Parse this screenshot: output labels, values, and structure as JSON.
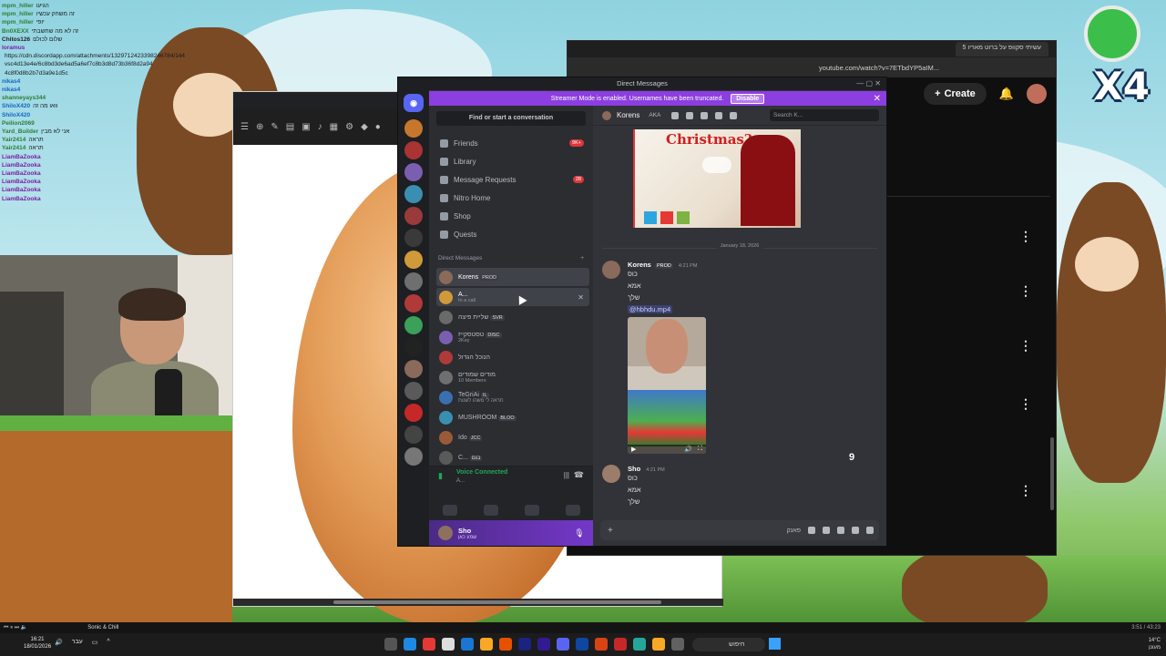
{
  "stream_chat": [
    {
      "user": "mpm_hiller",
      "text": "הגיעו",
      "color": "#2e7d32"
    },
    {
      "user": "mpm_hiller",
      "text": "זה משחק עכשיו",
      "color": "#2e7d32"
    },
    {
      "user": "mpm_hiller",
      "text": "יופי",
      "color": "#2e7d32"
    },
    {
      "user": "Bn0XEXX",
      "text": "זה לא מה שחשבתי",
      "color": "#2e7d32"
    },
    {
      "user": "Chitos126",
      "text": "שלום לכולם",
      "color": "#222222"
    },
    {
      "user": "loramus",
      "text": "",
      "color": "#7b1fa2"
    },
    {
      "user": "",
      "text": "https://cdn.discordapp.com/attachments/1329712423398246784/144",
      "color": "#222222"
    },
    {
      "user": "",
      "text": "vsc4d13e4e/6c8bd3de6ad5a6ef7c8b3d8d73b36f8d2a94",
      "color": "#222222"
    },
    {
      "user": "",
      "text": "4c8f0d8b2b7d3a9e1d5c",
      "color": "#222222"
    },
    {
      "user": "nikas4",
      "text": "",
      "color": "#1565c0"
    },
    {
      "user": "nikas4",
      "text": "",
      "color": "#1565c0"
    },
    {
      "user": "shanneyays344",
      "text": "",
      "color": "#2e7d32"
    },
    {
      "user": "ShiloX420",
      "text": "וואו מה זה",
      "color": "#1565c0"
    },
    {
      "user": "ShiloX420",
      "text": "",
      "color": "#1565c0"
    },
    {
      "user": "Peilion2069",
      "text": "",
      "color": "#2e7d32"
    },
    {
      "user": "Yard_Builder",
      "text": "אני לא מבין",
      "color": "#2e7d32"
    },
    {
      "user": "Yair2414",
      "text": "תראה",
      "color": "#2e7d32"
    },
    {
      "user": "Yair2414",
      "text": "תראה",
      "color": "#2e7d32"
    },
    {
      "user": "LiamBaZooka",
      "text": "",
      "color": "#7b1fa2"
    },
    {
      "user": "LiamBaZooka",
      "text": "",
      "color": "#7b1fa2"
    },
    {
      "user": "LiamBaZooka",
      "text": "",
      "color": "#7b1fa2"
    },
    {
      "user": "LiamBaZooka",
      "text": "",
      "color": "#7b1fa2"
    },
    {
      "user": "LiamBaZooka",
      "text": "",
      "color": "#7b1fa2"
    },
    {
      "user": "LiamBaZooka",
      "text": "",
      "color": "#7b1fa2"
    }
  ],
  "egg_window": {
    "toolbar_icons": [
      "☰",
      "⊕",
      "✎",
      "▤",
      "▣",
      "♪",
      "▦",
      "⚙",
      "◆",
      "●"
    ]
  },
  "youtube": {
    "tab_title": "עשיתי סקוופ על ברוט מאריו 5",
    "url": "youtube.com/watch?v=7ETbdYP5aIM...",
    "create_label": "Create",
    "x4_label": "X4"
  },
  "discord": {
    "window_title": "Direct Messages",
    "streamer_banner": "Streamer Mode is enabled. Usernames have been truncated.",
    "disable_label": "Disable",
    "search_placeholder": "Find or start a conversation",
    "nav": [
      {
        "label": "Friends",
        "badge": "9K+"
      },
      {
        "label": "Library",
        "badge": ""
      },
      {
        "label": "Message Requests",
        "badge": "28"
      },
      {
        "label": "Nitro Home",
        "badge": ""
      },
      {
        "label": "Shop",
        "badge": ""
      },
      {
        "label": "Quests",
        "badge": ""
      }
    ],
    "dm_header": "Direct Messages",
    "dm_add": "+",
    "dms": [
      {
        "name": "Korens",
        "tag": "PROD",
        "sub": "",
        "color": "#8a6a5a"
      },
      {
        "name": "A...",
        "tag": "",
        "sub": "In a call",
        "color": "#d09a3a"
      },
      {
        "name": "שליית פיצה",
        "tag": "SVR",
        "sub": "",
        "color": "#6a6a6a"
      },
      {
        "name": "טסטסקייז",
        "tag": "DISC",
        "sub": "2Key",
        "color": "#7a5fb0"
      },
      {
        "name": "הנוכל הגדול",
        "tag": "",
        "sub": "",
        "color": "#b03a3a"
      },
      {
        "name": "מודים שמודים",
        "tag": "",
        "sub": "10 Members",
        "color": "#6f6f6f"
      },
      {
        "name": "TeGriAi",
        "tag": "IL",
        "sub": "תראה לי משהו לשנות",
        "color": "#3a6fb0"
      },
      {
        "name": "MUSHROOM",
        "tag": "BLOO",
        "sub": "",
        "color": "#3a8fb0"
      },
      {
        "name": "Ido",
        "tag": "JCC",
        "sub": "",
        "color": "#9a5a3a"
      },
      {
        "name": "C...",
        "tag": "בגם",
        "sub": "",
        "color": "#5a5a5a"
      }
    ],
    "voice_status": "Voice Connected",
    "voice_sub": "A...",
    "user_name": "Sho",
    "user_status": "שמע כאן",
    "channel_name": "Korens",
    "channel_aka": "AKA",
    "channel_search": "Search K...",
    "xmas_word": "Christmas?",
    "date_divider": "January 18, 2026",
    "messages": [
      {
        "author": "Korens",
        "tag": "PROD",
        "time": "4:21 PM",
        "lines": [
          "כוס",
          "אמא",
          "שלך"
        ],
        "link": "@hbhdu.mp4"
      },
      {
        "author": "Sho",
        "tag": "",
        "time": "4:21 PM",
        "lines": [
          "כוס",
          "אמא",
          "שלך"
        ],
        "link": ""
      }
    ],
    "composer_hint": "פאנק",
    "composer_plus": "+"
  },
  "page_counter": "9",
  "taskbar": {
    "stream_title": "Sonic & Chill",
    "stream_timer": "3:51 / 43:23",
    "clock_time": "16:21",
    "clock_date": "18/01/2026",
    "language": "עבר",
    "search_label": "חיפוש",
    "weather": "14°C",
    "weather_desc": "מעונן"
  }
}
